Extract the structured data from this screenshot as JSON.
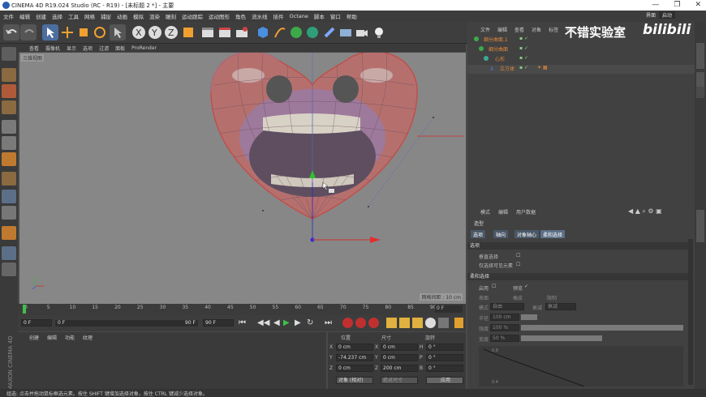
{
  "title_bar": {
    "title": "CINEMA 4D R19.024 Studio (RC - R19) - [未标题 2 *] - 主要",
    "min": "—",
    "max": "❐",
    "close": "✕"
  },
  "menu": [
    "文件",
    "编辑",
    "创建",
    "选择",
    "工具",
    "网格",
    "捕捉",
    "动画",
    "模拟",
    "渲染",
    "雕刻",
    "运动跟踪",
    "运动图形",
    "角色",
    "流水线",
    "插件",
    "Octane",
    "脚本",
    "窗口",
    "帮助"
  ],
  "layout_menu": {
    "label": "界面",
    "value": "启动"
  },
  "viewport": {
    "menu": [
      "查看",
      "摄像机",
      "显示",
      "选项",
      "过滤",
      "面板",
      "ProRender"
    ],
    "label": "三维视图",
    "grid_readout": "网格间距 : 10 cm"
  },
  "timeline": {
    "ticks": [
      "0",
      "5",
      "10",
      "15",
      "20",
      "25",
      "30",
      "35",
      "40",
      "45",
      "50",
      "55",
      "60",
      "65",
      "70",
      "75",
      "80",
      "85",
      "90"
    ],
    "current_frame_display": "0 F",
    "playhead_frame": 0
  },
  "transport": {
    "start": "0 F",
    "scrub": "0 F",
    "end_a": "90 F",
    "end_b": "90 F"
  },
  "material_manager": {
    "menu": [
      "创建",
      "编辑",
      "功能",
      "纹理"
    ]
  },
  "coordinates": {
    "headers": [
      "位置",
      "尺寸",
      "旋转"
    ],
    "rows": [
      {
        "axis": "X",
        "pos": "0 cm",
        "size_axis": "X",
        "size": "0 cm",
        "rot_axis": "H",
        "rot": "0 °"
      },
      {
        "axis": "Y",
        "pos": "-74.237 cm",
        "size_axis": "Y",
        "size": "0 cm",
        "rot_axis": "P",
        "rot": "0 °"
      },
      {
        "axis": "Z",
        "pos": "0 cm",
        "size_axis": "Z",
        "size": "200 cm",
        "rot_axis": "B",
        "rot": "0 °"
      }
    ],
    "mode": "对象 (相对)",
    "size_mode": "绝对尺寸",
    "apply": "应用"
  },
  "status_text": "组选: 点击并拖动鼠标框选元素。按住 SHIFT 键增加选择对象，按住 CTRL 键减少选择对象。",
  "object_manager": {
    "menu": [
      "文件",
      "编辑",
      "查看",
      "对象",
      "标签",
      "书签"
    ],
    "items": [
      {
        "name": "细分曲面.1",
        "indent": 0
      },
      {
        "name": "细分曲面",
        "indent": 1
      },
      {
        "name": "心形",
        "indent": 2
      },
      {
        "name": "立方体",
        "indent": 3
      }
    ]
  },
  "watermark": {
    "text": "不错实验室",
    "logo": "bilibili"
  },
  "attributes": {
    "menu": [
      "模式",
      "编辑",
      "用户数据"
    ],
    "title": "造型",
    "tabs": [
      "选项",
      "轴向",
      "对象轴心",
      "柔和选择"
    ],
    "active_tab": 3,
    "sections": [
      {
        "name": "选项",
        "rows": [
          "垂直选择",
          "仅选择可见元素"
        ]
      },
      {
        "name": "柔和选择",
        "rows": [
          "启用",
          "预览",
          "表面",
          "橡皮",
          "限制",
          "模式",
          "衰减",
          "半径",
          "强度",
          "宽度"
        ]
      }
    ],
    "radius": "100 cm",
    "strength": "100 %",
    "width": "50 %",
    "mode_value": "自由",
    "falloff_value": "衰减"
  },
  "left_strip": {
    "brand": "MAXON CINEMA 4D"
  },
  "graph_ticks": [
    "0.8",
    "0.4"
  ],
  "colors": {
    "accent": "#5b6f87",
    "selection": "#e05a4a"
  }
}
